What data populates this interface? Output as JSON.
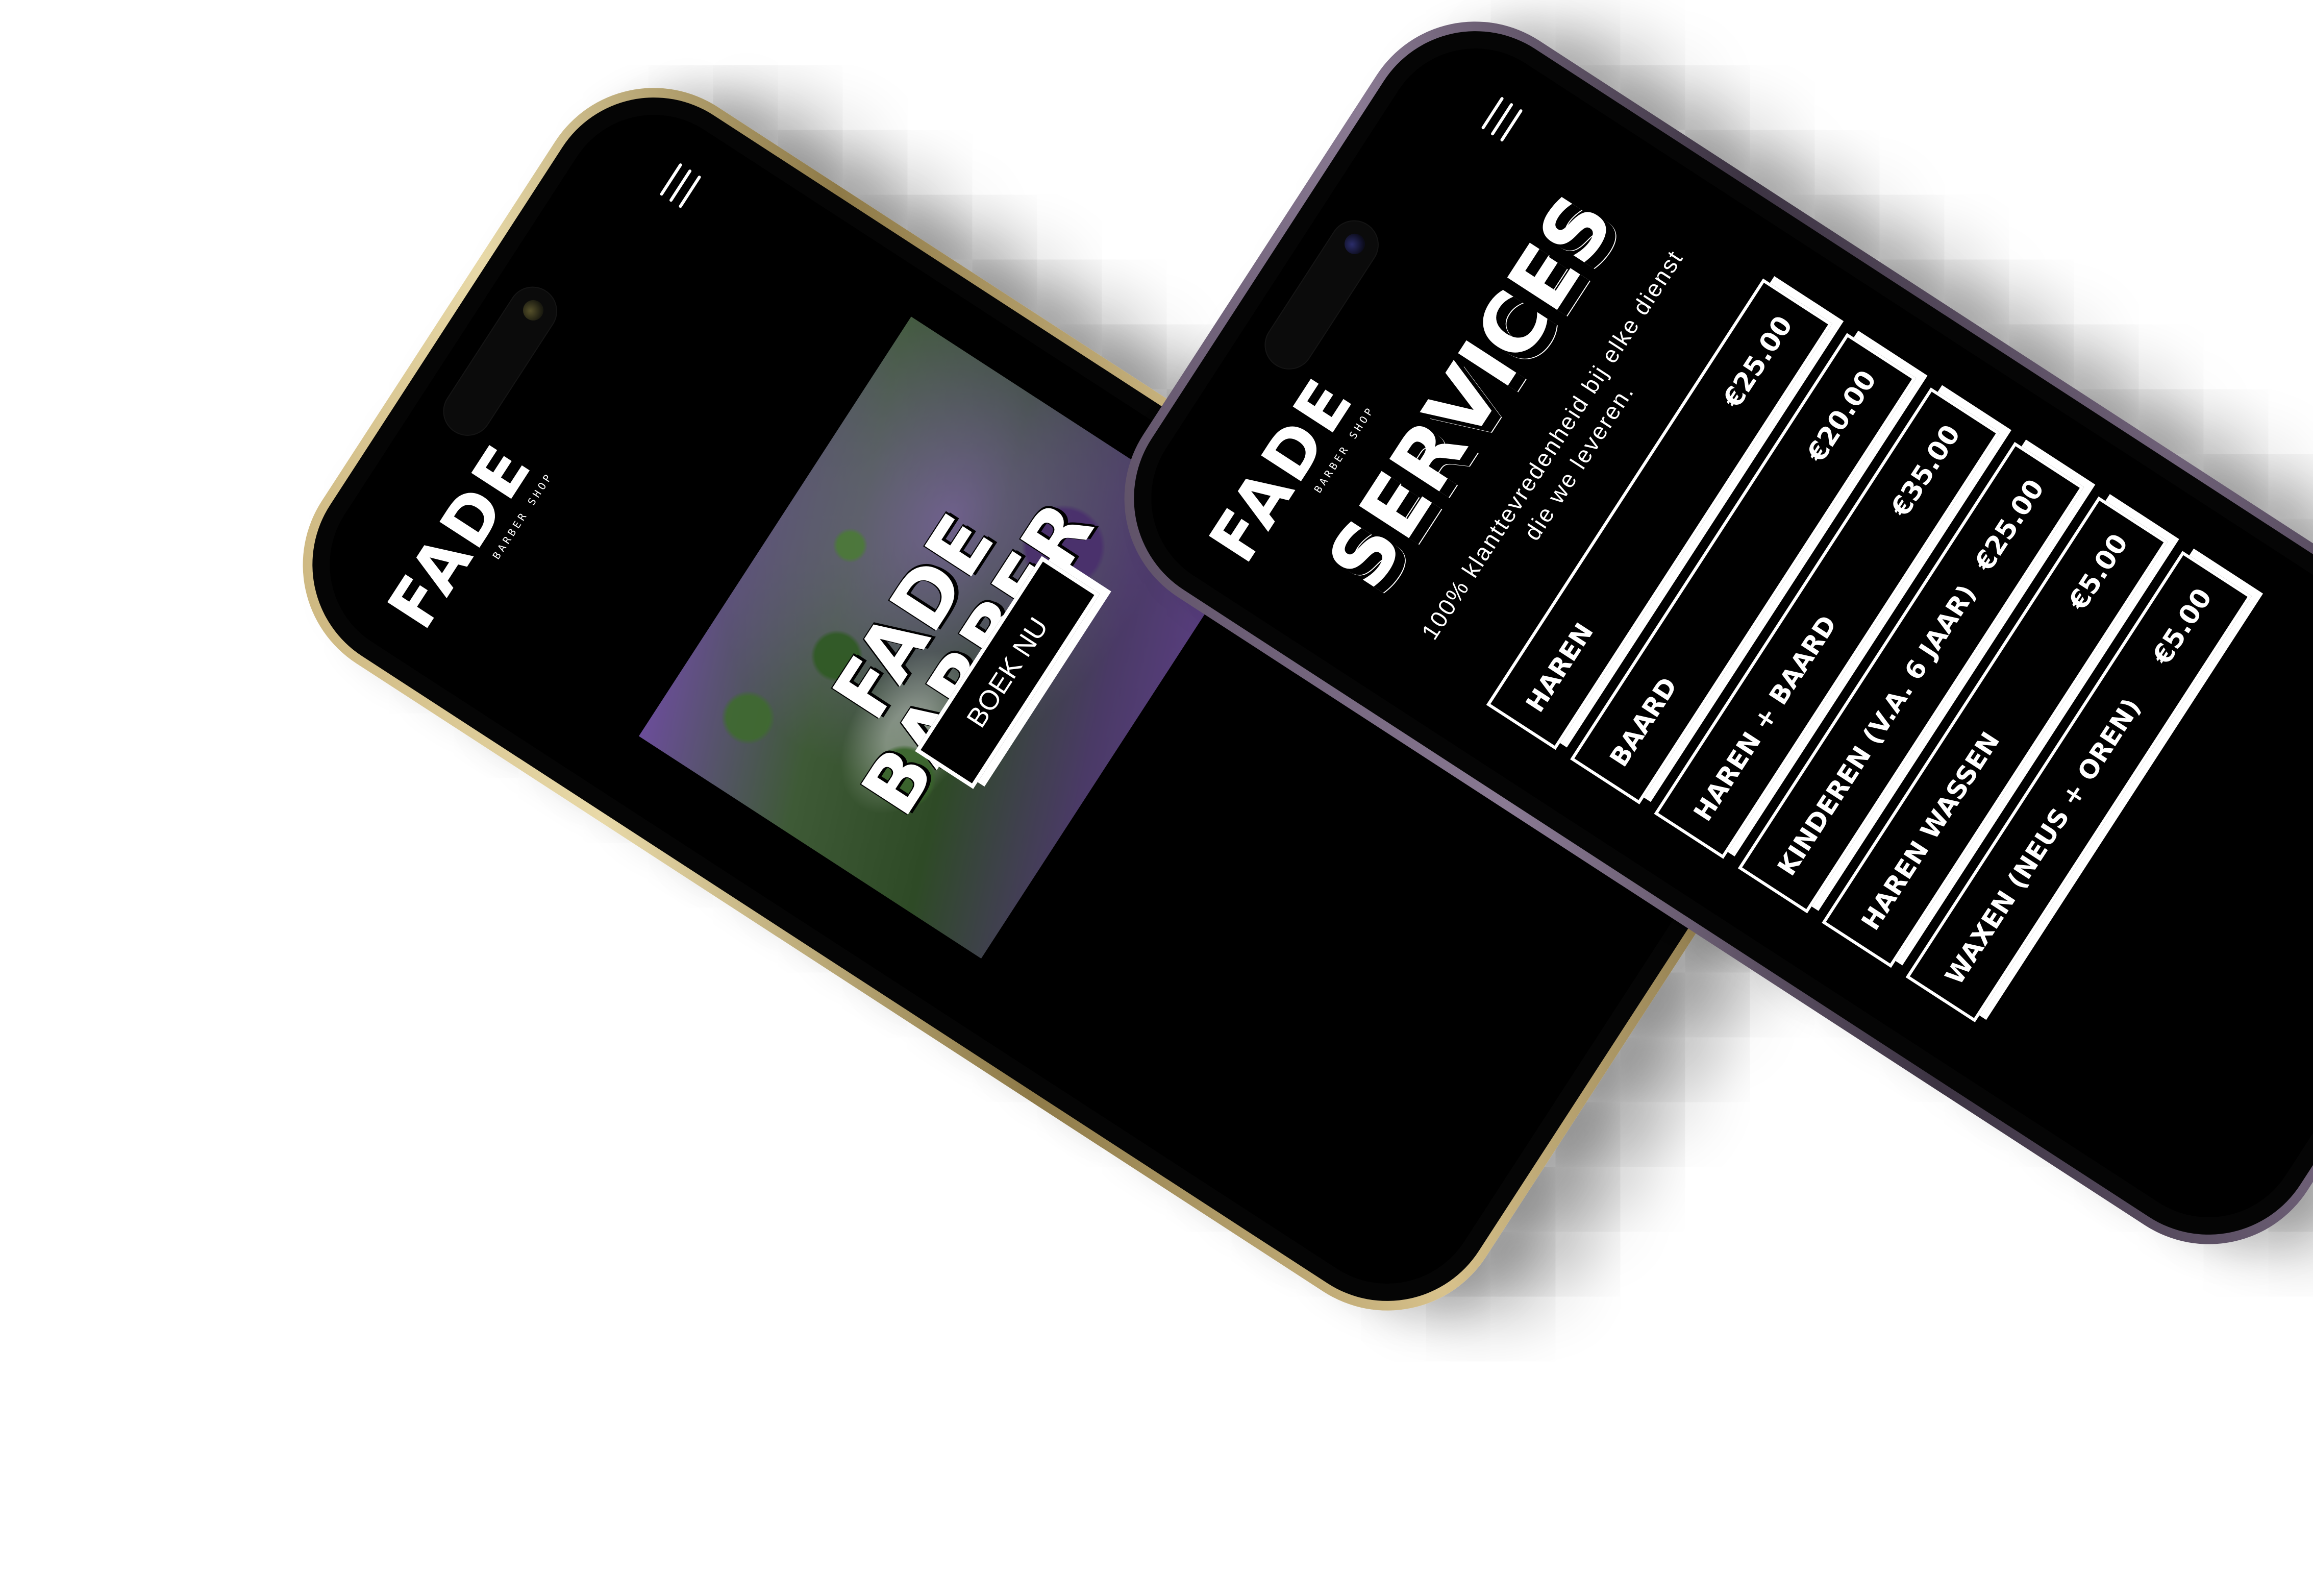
{
  "brand": {
    "logo_text": "FADE",
    "logo_sub": "BARBER SHOP"
  },
  "home": {
    "hero_title": "FADE BARBER",
    "cta_label": "BOEK NU"
  },
  "services": {
    "title": "SERVICES",
    "subtitle": "100% klanttevredenheid bij elke dienst die we leveren.",
    "items": [
      {
        "name": "HAREN",
        "price": "€25.00"
      },
      {
        "name": "BAARD",
        "price": "€20.00"
      },
      {
        "name": "HAREN + BAARD",
        "price": "€35.00"
      },
      {
        "name": "KINDEREN (V.A. 6 JAAR)",
        "price": "€25.00"
      },
      {
        "name": "HAREN WASSEN",
        "price": "€5.00"
      },
      {
        "name": "WAXEN (NEUS + OREN)",
        "price": "€5.00"
      }
    ]
  },
  "colors": {
    "background": "#ffffff",
    "screen": "#000000",
    "text": "#ffffff",
    "phone_left_frame": "#c9b27a",
    "phone_right_frame": "#5a4d63",
    "hero_accent": "#6b4d9a"
  }
}
